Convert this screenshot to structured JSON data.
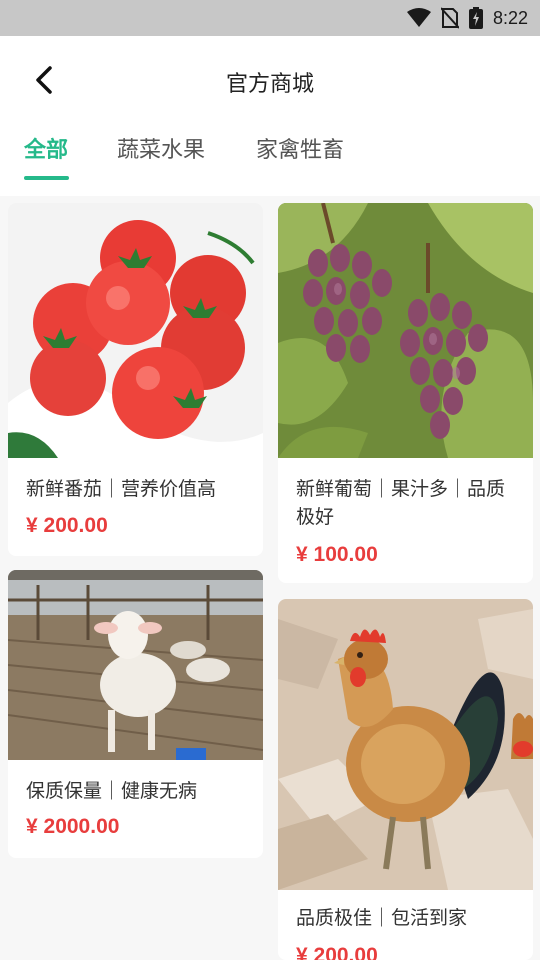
{
  "status": {
    "time": "8:22"
  },
  "header": {
    "title": "官方商城"
  },
  "tabs": [
    {
      "label": "全部",
      "active": true
    },
    {
      "label": "蔬菜水果",
      "active": false
    },
    {
      "label": "家禽牲畜",
      "active": false
    }
  ],
  "products": [
    {
      "title": "新鲜番茄｜营养价值高",
      "price": "¥ 200.00",
      "image": "tomato"
    },
    {
      "title": "新鲜葡萄｜果汁多｜品质极好",
      "price": "¥ 100.00",
      "image": "grape"
    },
    {
      "title": "保质保量｜健康无病",
      "price": "¥ 2000.00",
      "image": "sheep"
    },
    {
      "title": "品质极佳｜包活到家",
      "price": "¥ 200.00",
      "image": "chicken"
    }
  ],
  "colors": {
    "accent": "#25b98a",
    "price": "#e83d3d"
  }
}
